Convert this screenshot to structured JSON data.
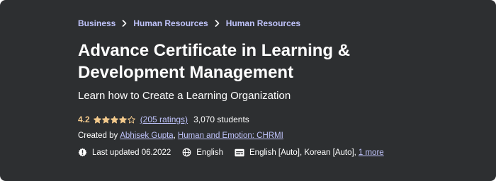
{
  "breadcrumb": {
    "items": [
      "Business",
      "Human Resources",
      "Human Resources"
    ]
  },
  "course": {
    "title_line1": "Advance Certificate in Learning &",
    "title_line2": "Development Management",
    "subtitle": "Learn how to Create a Learning Organization",
    "rating": {
      "value": "4.2",
      "stars": 4.2,
      "max_stars": 5,
      "count_label": "(205 ratings)",
      "students": "3,070 students"
    },
    "created_by": {
      "prefix": "Created by",
      "authors": [
        "Abhisek Gupta",
        "Human and Emotion: CHRMI"
      ]
    },
    "meta": {
      "updated": "Last updated 06.2022",
      "language": "English",
      "captions": "English [Auto], Korean [Auto],",
      "more": "1 more"
    }
  },
  "icons": {
    "separator": "chevron-right-icon",
    "updated": "alert-badge-icon",
    "language": "globe-icon",
    "captions": "closed-captions-icon",
    "star": "star-icon"
  },
  "colors": {
    "background": "#2d2f31",
    "link": "#c0c4fc",
    "rating": "#f3ca8c",
    "text": "#ffffff"
  }
}
